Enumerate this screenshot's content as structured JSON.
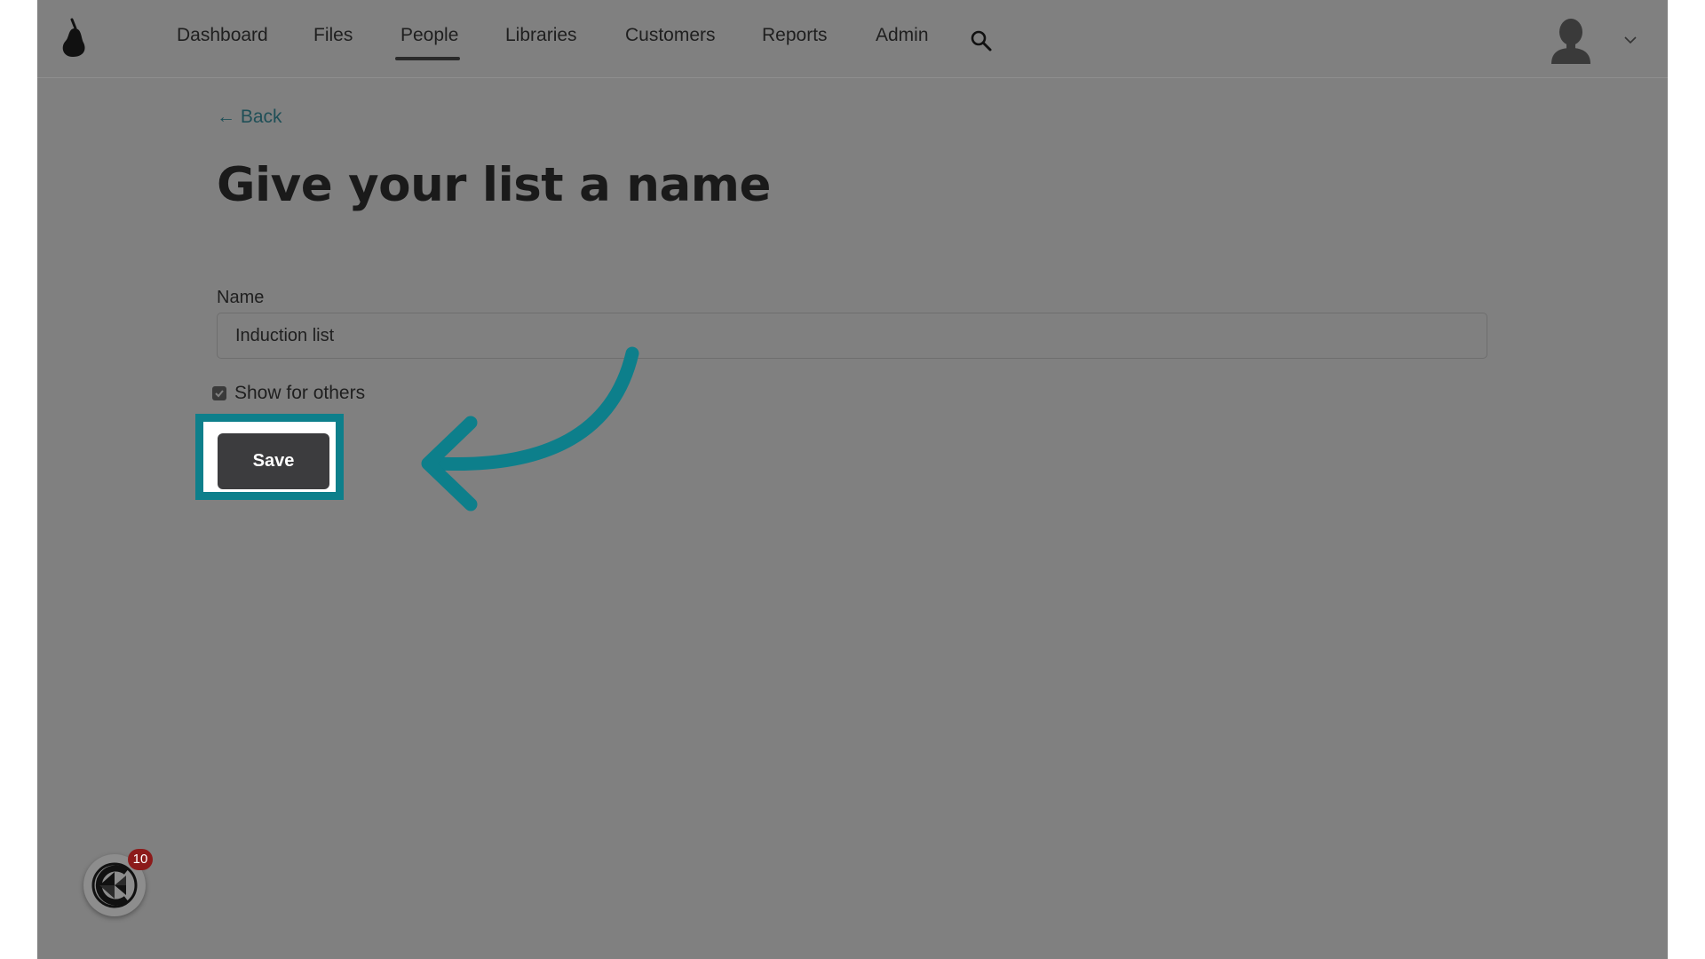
{
  "nav": {
    "items": [
      {
        "label": "Dashboard",
        "active": false
      },
      {
        "label": "Files",
        "active": false
      },
      {
        "label": "People",
        "active": true
      },
      {
        "label": "Libraries",
        "active": false
      },
      {
        "label": "Customers",
        "active": false
      },
      {
        "label": "Reports",
        "active": false
      },
      {
        "label": "Admin",
        "active": false
      }
    ],
    "icons": {
      "logo": "pear-logo-icon",
      "search": "search-icon",
      "avatar": "user-avatar-icon",
      "menu": "chevron-down-icon"
    }
  },
  "page": {
    "back_label": "← Back",
    "title": "Give your list a name"
  },
  "form": {
    "name_label": "Name",
    "name_value": "Induction list",
    "show_for_others_label": "Show for others",
    "show_for_others_checked": true,
    "save_label": "Save"
  },
  "widget": {
    "badge_count": "10",
    "icon": "help-launcher-icon"
  },
  "colors": {
    "overlay": "#808080",
    "highlight": "#0d7f8b",
    "button": "#3c3c3e",
    "badge": "#8c1a1a"
  }
}
